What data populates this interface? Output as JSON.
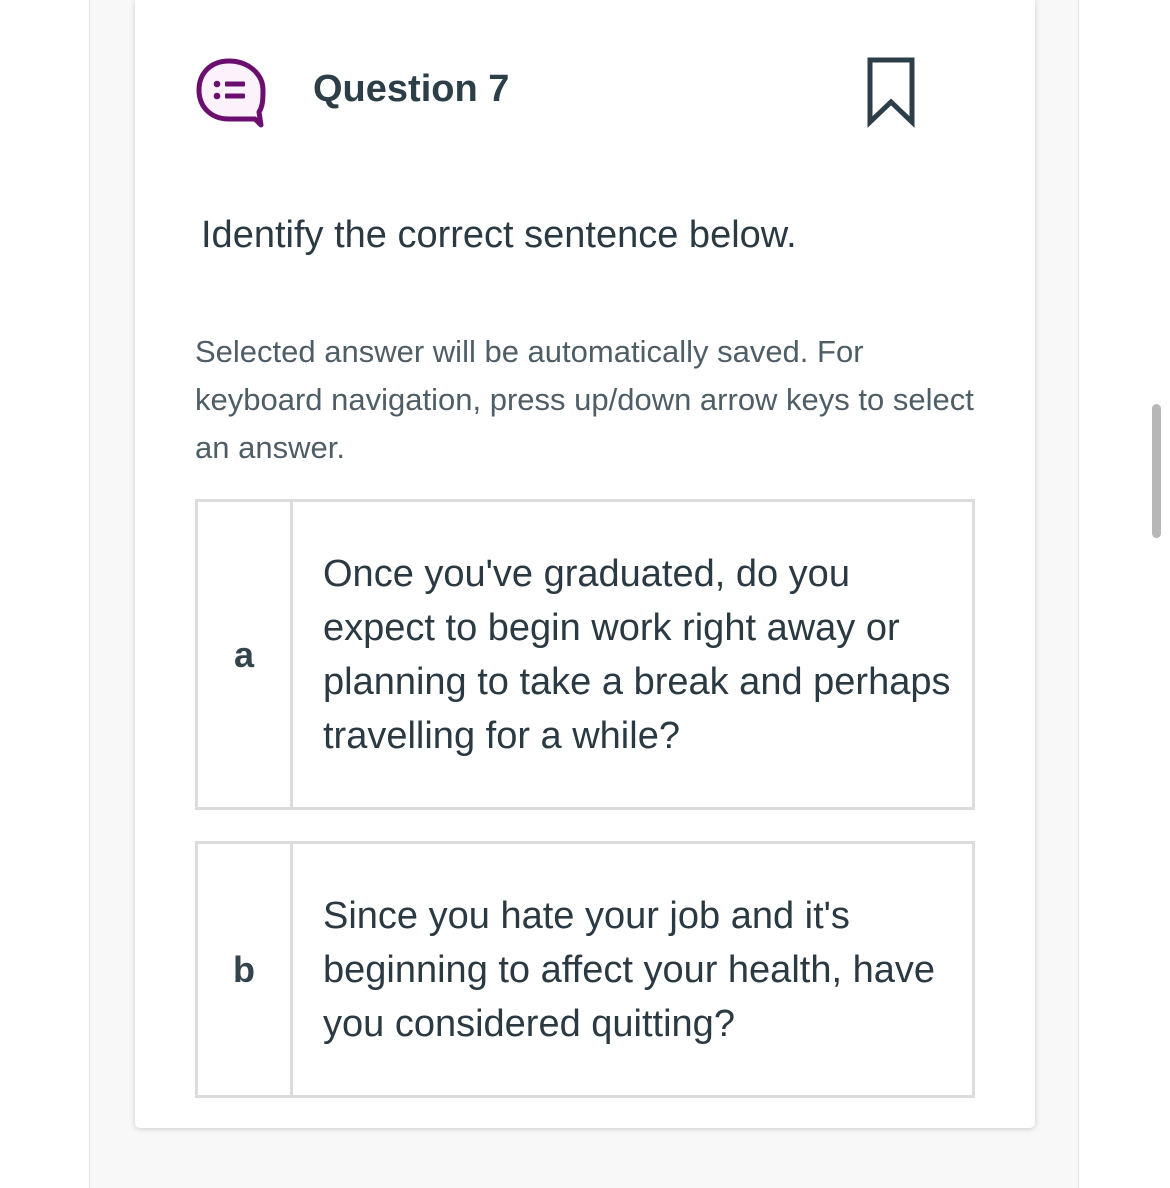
{
  "question": {
    "title": "Question 7",
    "prompt": "Identify the correct sentence below.",
    "instructions": "Selected answer will be automatically saved. For keyboard navigation, press up/down arrow keys to select an answer.",
    "icon": "question-list-icon",
    "bookmark_icon": "bookmark-icon"
  },
  "options": [
    {
      "letter": "a",
      "text": "Once you've graduated, do you expect to begin work right away or planning to take a break and perhaps travelling for a while?"
    },
    {
      "letter": "b",
      "text": "Since you hate your job and it's beginning to affect your health, have you considered quitting?"
    }
  ],
  "colors": {
    "accent": "#6b0f6e",
    "text": "#2b3a42",
    "muted_text": "#4f5e66",
    "border": "#dcdcdc",
    "bookmark": "#2c3e48"
  }
}
